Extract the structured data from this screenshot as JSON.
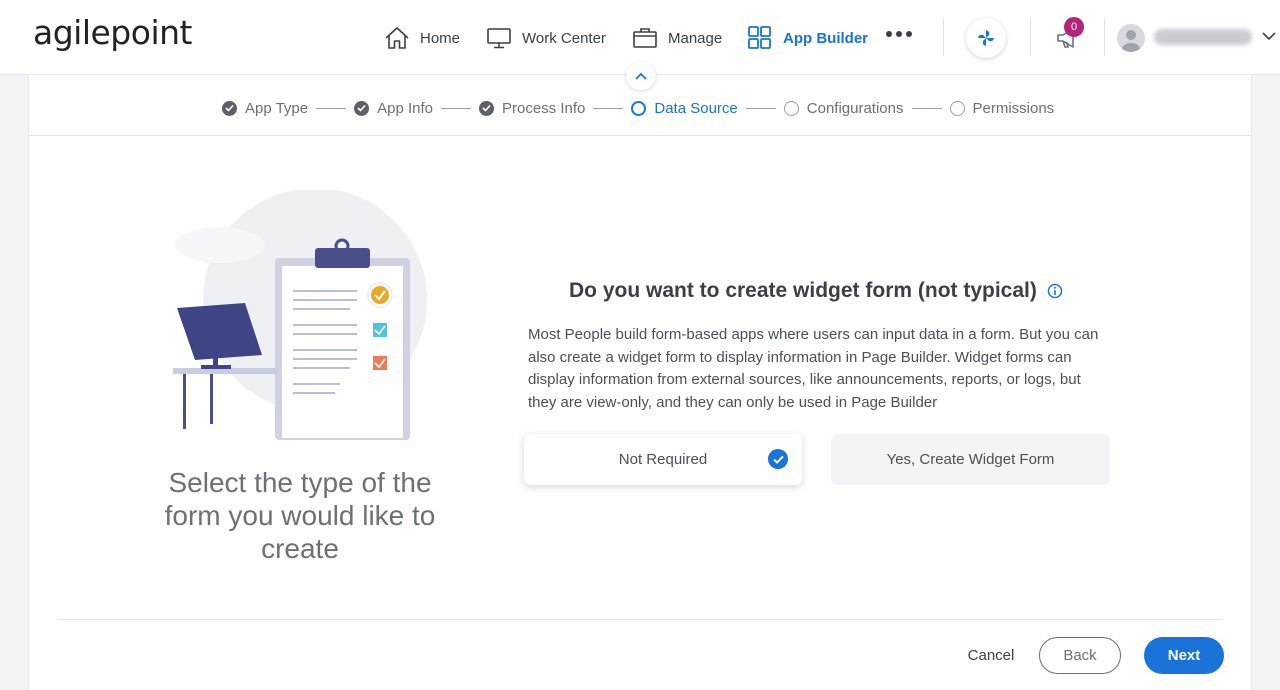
{
  "brand": {
    "logo_text": "agilepoint"
  },
  "nav": {
    "home": "Home",
    "work_center": "Work Center",
    "manage": "Manage",
    "app_builder": "App Builder",
    "notification_count": "0",
    "accent_color": "#1a73d9"
  },
  "stepper": {
    "steps": [
      {
        "label": "App Type",
        "state": "done"
      },
      {
        "label": "App Info",
        "state": "done"
      },
      {
        "label": "Process Info",
        "state": "done"
      },
      {
        "label": "Data Source",
        "state": "current"
      },
      {
        "label": "Configurations",
        "state": "todo"
      },
      {
        "label": "Permissions",
        "state": "todo"
      }
    ]
  },
  "left_panel": {
    "tagline": "Select the type of the form you would like to create"
  },
  "main": {
    "question": "Do you want to create widget form (not typical)",
    "description": "Most People build form-based apps where users can input data in a form. But you can also create a widget form to display information in Page Builder. Widget forms can display information from external sources, like announcements, reports, or logs, but they are view-only, and they can only be used in Page Builder",
    "options": [
      {
        "label": "Not Required",
        "selected": true
      },
      {
        "label": "Yes, Create Widget Form",
        "selected": false
      }
    ]
  },
  "footer": {
    "cancel": "Cancel",
    "back": "Back",
    "next": "Next"
  }
}
